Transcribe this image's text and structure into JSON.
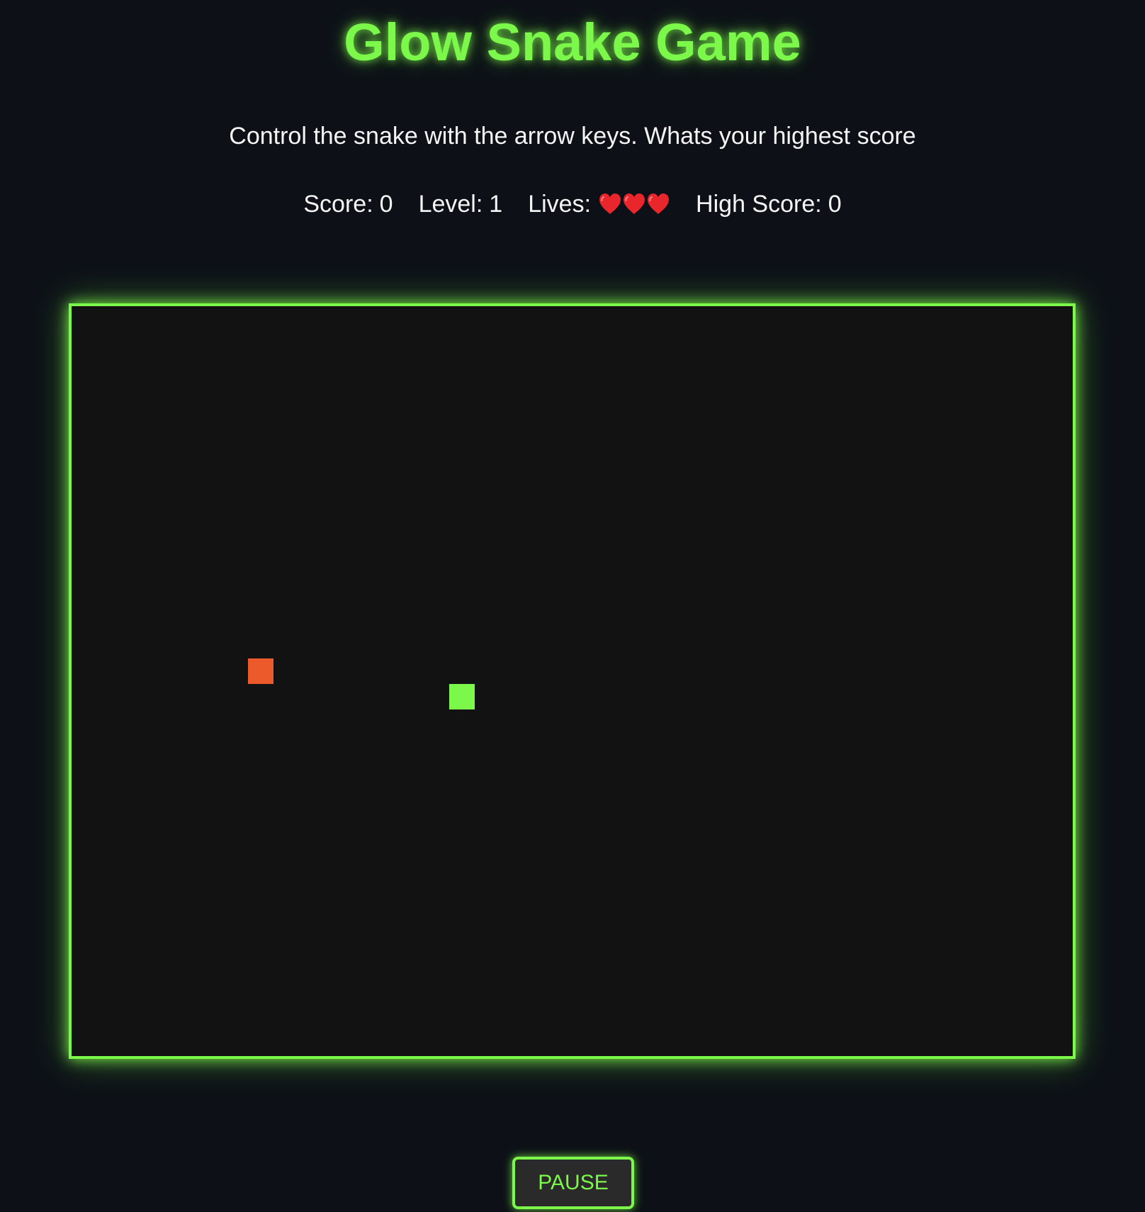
{
  "app": {
    "title": "Glow Snake Game",
    "instructions": "Control the snake with the arrow keys. Whats your highest score"
  },
  "stats": {
    "score_label": "Score:",
    "score": "0",
    "level_label": "Level:",
    "level": "1",
    "lives_label": "Lives:",
    "lives": 3,
    "high_score_label": "High Score:",
    "high_score": "0"
  },
  "board": {
    "border_color": "#7bf84a",
    "background_color": "#121212",
    "food_color": "#ec5a2c",
    "snake_color": "#7bf84a"
  },
  "controls": {
    "pause_label": "PAUSE"
  },
  "icons": {
    "life": "heart-icon"
  }
}
